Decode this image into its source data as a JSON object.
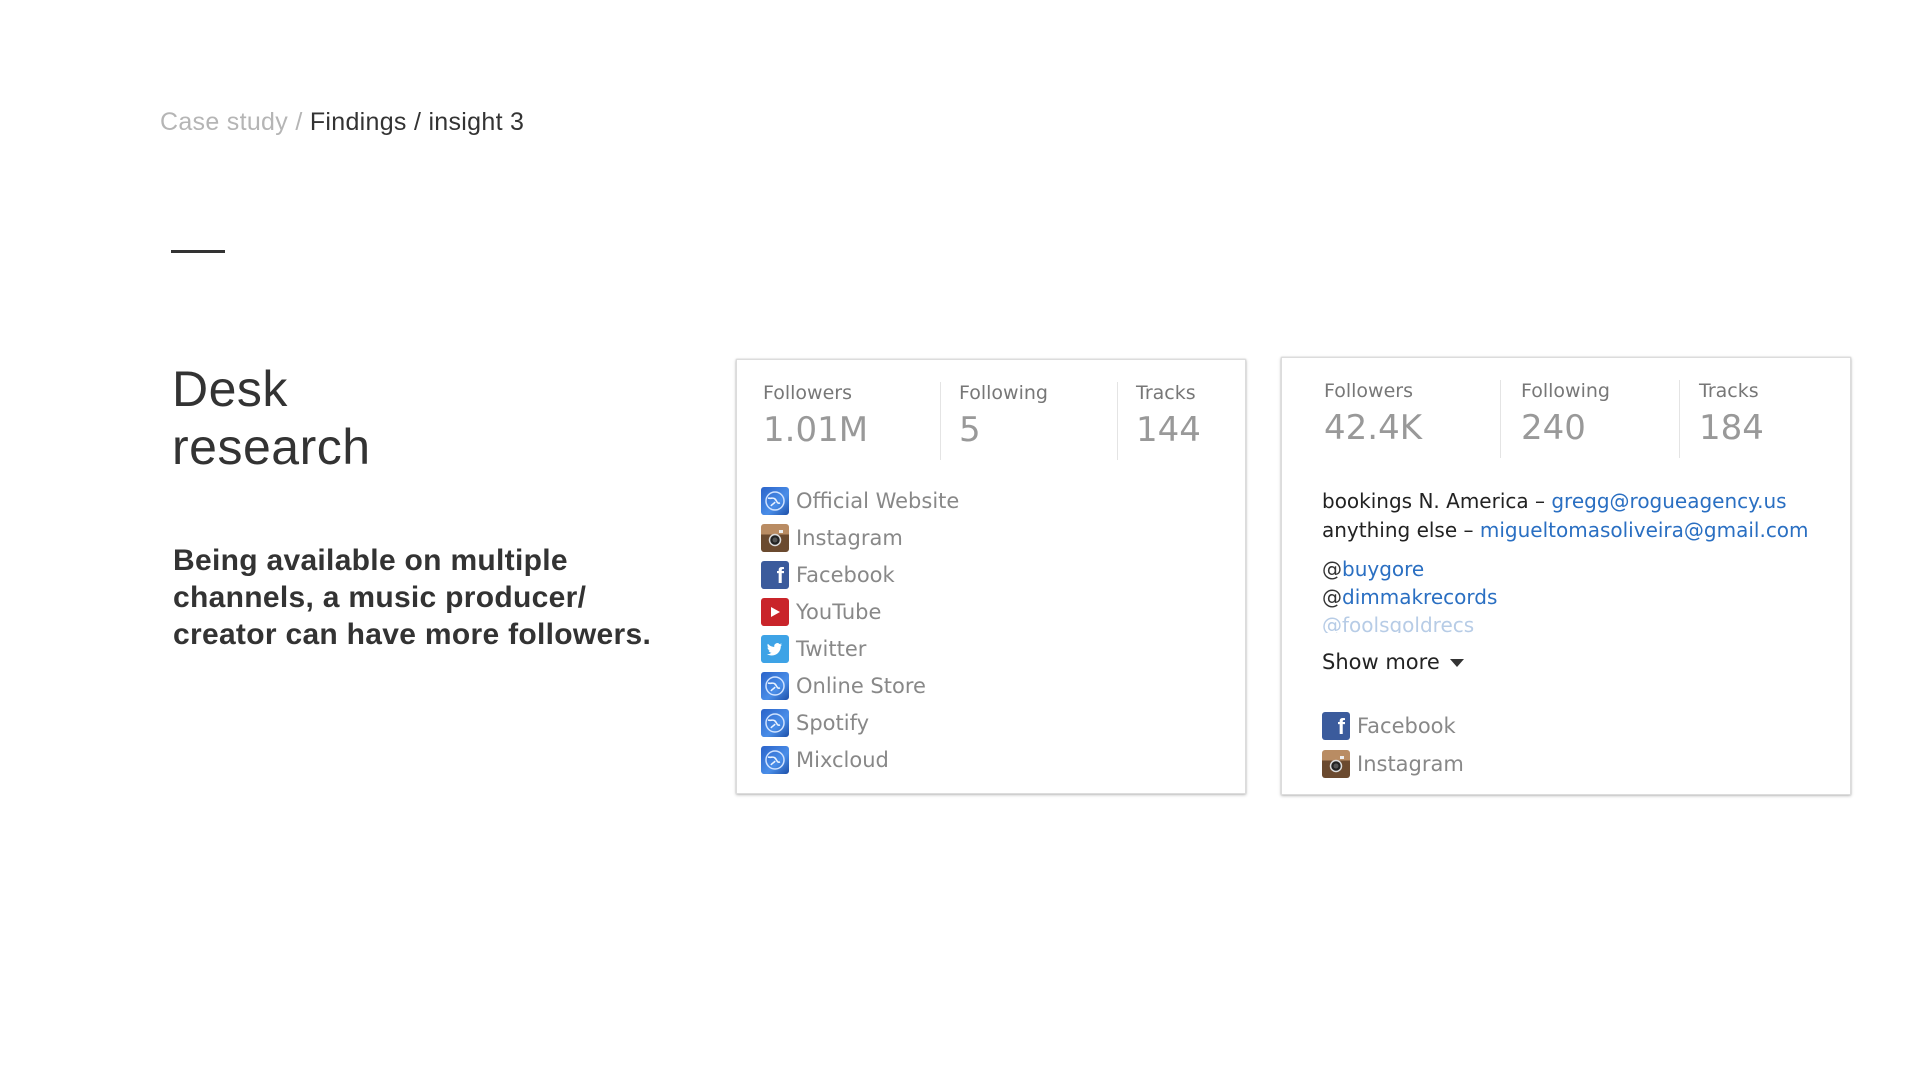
{
  "breadcrumb": {
    "part1": "Case study",
    "separator": "/",
    "part2": "Findings / insight 3"
  },
  "heading": {
    "line1": "Desk",
    "line2": "research"
  },
  "insight": "Being available on multiple channels, a music producer/ creator can have more followers.",
  "card1": {
    "stats": [
      {
        "label": "Followers",
        "value": "1.01M"
      },
      {
        "label": "Following",
        "value": "5"
      },
      {
        "label": "Tracks",
        "value": "144"
      }
    ],
    "links": [
      {
        "icon": "globe-icon",
        "label": "Official Website"
      },
      {
        "icon": "instagram-icon",
        "label": "Instagram"
      },
      {
        "icon": "facebook-icon",
        "label": "Facebook"
      },
      {
        "icon": "youtube-icon",
        "label": "YouTube"
      },
      {
        "icon": "twitter-icon",
        "label": "Twitter"
      },
      {
        "icon": "globe-icon",
        "label": "Online Store"
      },
      {
        "icon": "globe-icon",
        "label": "Spotify"
      },
      {
        "icon": "globe-icon",
        "label": "Mixcloud"
      }
    ]
  },
  "card2": {
    "stats": [
      {
        "label": "Followers",
        "value": "42.4K"
      },
      {
        "label": "Following",
        "value": "240"
      },
      {
        "label": "Tracks",
        "value": "184"
      }
    ],
    "contact": [
      {
        "prefix": "bookings N. America – ",
        "email": "gregg@rogueagency.us"
      },
      {
        "prefix": "anything else – ",
        "email": "migueltomasoliveira@gmail.com"
      }
    ],
    "handles": [
      {
        "at": "@",
        "name": "buygore"
      },
      {
        "at": "@",
        "name": "dimmakrecords"
      },
      {
        "at": "@",
        "name": "foolsgoldrecs"
      }
    ],
    "show_more": "Show more",
    "links": [
      {
        "icon": "facebook-icon",
        "label": "Facebook"
      },
      {
        "icon": "instagram-icon",
        "label": "Instagram"
      }
    ]
  },
  "colors": {
    "link_blue": "#2a6fc2",
    "text_dark": "#333333",
    "text_muted": "#888888"
  }
}
